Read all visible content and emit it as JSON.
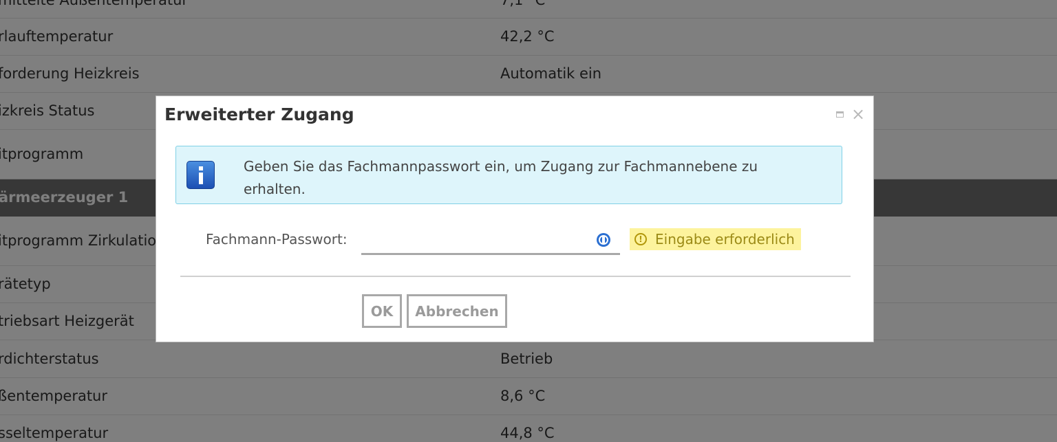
{
  "background_table": {
    "rows": [
      {
        "label": "mittelte Außentemperatur",
        "value": "7,1 °C",
        "section": false
      },
      {
        "label": "rlauftemperatur",
        "value": "42,2 °C",
        "section": false
      },
      {
        "label": "forderung Heizkreis",
        "value": "Automatik ein",
        "section": false
      },
      {
        "label": "izkreis Status",
        "value": "",
        "section": false
      },
      {
        "label": "itprogramm",
        "value": "",
        "section": false
      },
      {
        "label": "ärmeerzeuger 1",
        "value": "",
        "section": true
      },
      {
        "label": "itprogramm Zirkulation",
        "value": "",
        "section": false
      },
      {
        "label": "rätetyp",
        "value": "",
        "section": false
      },
      {
        "label": "triebsart Heizgerät",
        "value": "",
        "section": false
      },
      {
        "label": "rdichterstatus",
        "value": "Betrieb",
        "section": false
      },
      {
        "label": "ßentemperatur",
        "value": "8,6 °C",
        "section": false
      },
      {
        "label": "sseltemperatur",
        "value": "44,8 °C",
        "section": false
      }
    ]
  },
  "dialog": {
    "title": "Erweiterter Zugang",
    "info_message": "Geben Sie das Fachmannpasswort ein, um Zugang zur Fachmannebene zu erhalten.",
    "password_label": "Fachmann-Passwort:",
    "password_value": "",
    "password_placeholder": "",
    "validation_message": "Eingabe erforderlich",
    "ok_label": "OK",
    "cancel_label": "Abbrechen",
    "icons": {
      "maximize": "maximize-icon",
      "close": "close-icon",
      "info": "info-icon",
      "password_manager": "password-manager-icon",
      "warning": "warning-icon"
    }
  },
  "colors": {
    "info_background": "#def5fb",
    "info_border": "#7fd0e6",
    "warning_background": "#fdf39d",
    "section_header": "#6e6e6e"
  }
}
